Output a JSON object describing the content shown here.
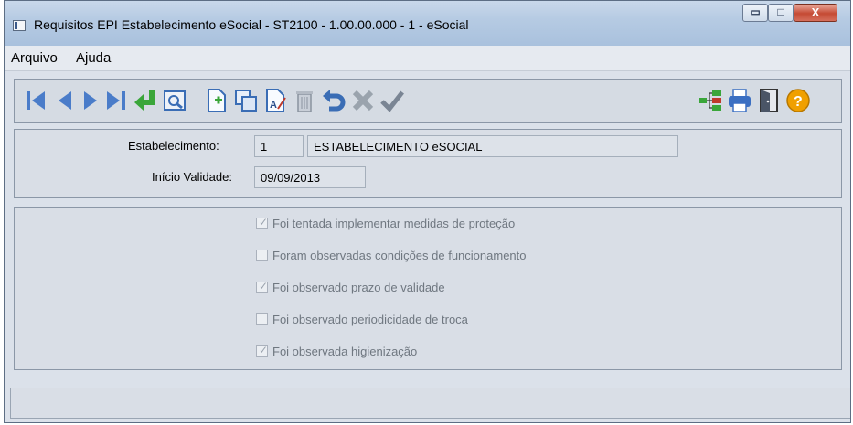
{
  "window": {
    "title": "Requisitos EPI Estabelecimento eSocial - ST2100 - 1.00.00.000 - 1 - eSocial",
    "controls": {
      "minimize": "▭",
      "maximize": "□",
      "close": "X"
    }
  },
  "menu": [
    "Arquivo",
    "Ajuda"
  ],
  "toolbar": {
    "left_icons": [
      "first-record-icon",
      "previous-record-icon",
      "next-record-icon",
      "last-record-icon",
      "enter-icon",
      "preview-icon",
      "new-record-icon",
      "copy-icon",
      "edit-icon",
      "delete-icon",
      "undo-icon",
      "cancel-icon",
      "confirm-icon"
    ],
    "right_icons": [
      "tree-icon",
      "print-icon",
      "exit-door-icon",
      "help-icon"
    ],
    "colors": {
      "navigation": "#4a7cc9",
      "enter": "#3aa63a",
      "print": "#3b6fc2",
      "help": "#f0a000",
      "cancel": "#9aa3ad"
    }
  },
  "form": {
    "estabelecimento_label": "Estabelecimento:",
    "estabelecimento_code": "1",
    "estabelecimento_name": "ESTABELECIMENTO eSOCIAL",
    "inicio_label": "Início Validade:",
    "inicio_value": "09/09/2013"
  },
  "checks": [
    {
      "label": "Foi tentada implementar medidas de proteção",
      "checked": true
    },
    {
      "label": "Foram observadas condições de funcionamento",
      "checked": false
    },
    {
      "label": "Foi observado prazo de validade",
      "checked": true
    },
    {
      "label": "Foi observado periodicidade de troca",
      "checked": false
    },
    {
      "label": "Foi observada higienização",
      "checked": true
    }
  ]
}
